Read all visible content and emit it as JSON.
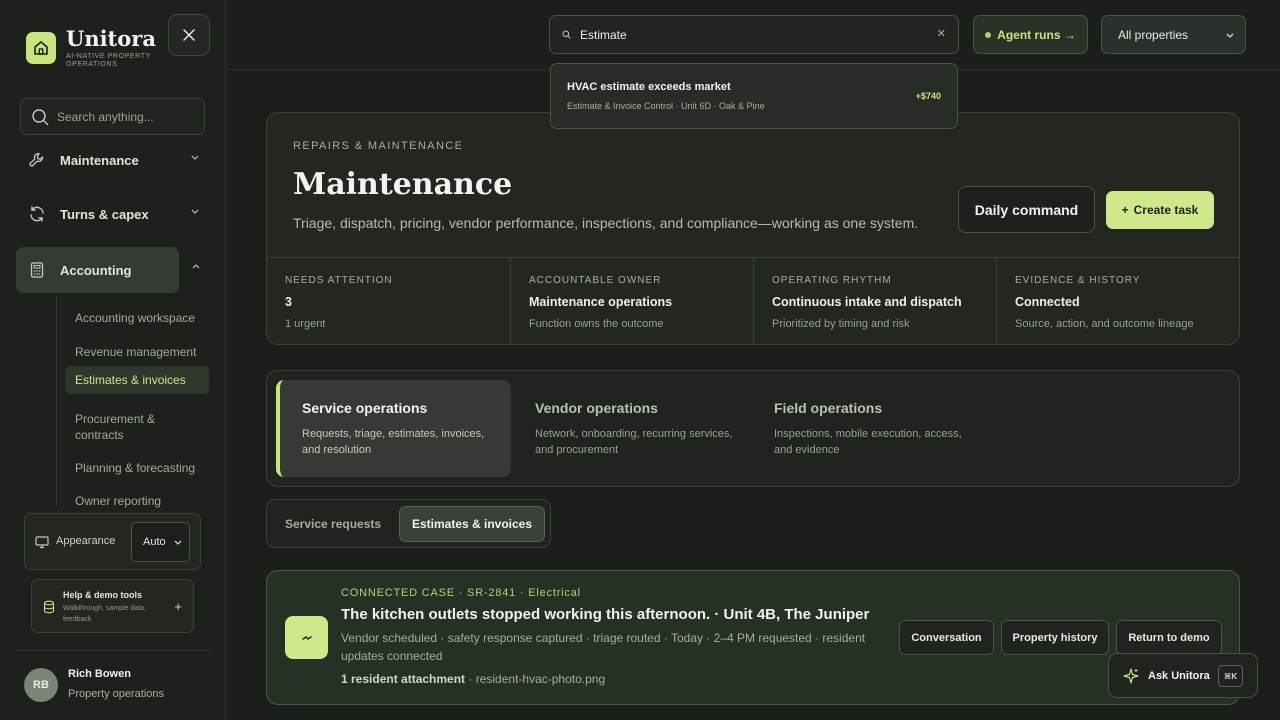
{
  "brand": {
    "name": "Unitora",
    "tagline": "AI-NATIVE PROPERTY OPERATIONS"
  },
  "sidebar": {
    "search_placeholder": "Search anything...",
    "nav": [
      {
        "label": "Maintenance",
        "icon": "wrench-icon"
      },
      {
        "label": "Turns & capex",
        "icon": "refresh-icon"
      },
      {
        "label": "Accounting",
        "icon": "calculator-icon",
        "expanded": true
      }
    ],
    "sub_items": [
      "Accounting workspace",
      "Revenue management",
      "Estimates & invoices",
      "Procurement & contracts",
      "Planning & forecasting",
      "Owner reporting"
    ],
    "active_sub": "Estimates & invoices",
    "appearance": {
      "label": "Appearance",
      "value": "Auto"
    },
    "help": {
      "title": "Help & demo tools",
      "subtitle": "Walkthrough, sample data, feedback"
    },
    "user": {
      "initials": "RB",
      "name": "Rich Bowen",
      "role": "Property operations"
    }
  },
  "topbar": {
    "search_value": "Estimate",
    "agent_runs": "Agent runs →",
    "property_select": "All properties"
  },
  "search_result": {
    "title": "HVAC estimate exceeds market",
    "subtitle": "Estimate & Invoice Control · Unit 6D · Oak & Pine",
    "amount": "+$740"
  },
  "header": {
    "eyebrow": "REPAIRS & MAINTENANCE",
    "title": "Maintenance",
    "subtitle": "Triage, dispatch, pricing, vendor performance, inspections, and compliance—working as one system.",
    "daily_btn": "Daily command",
    "create_btn": "Create task",
    "stats": [
      {
        "key": "NEEDS ATTENTION",
        "value": "3",
        "detail": "1 urgent"
      },
      {
        "key": "ACCOUNTABLE OWNER",
        "value": "Maintenance operations",
        "detail": "Function owns the outcome"
      },
      {
        "key": "OPERATING RHYTHM",
        "value": "Continuous intake and dispatch",
        "detail": "Prioritized by timing and risk"
      },
      {
        "key": "EVIDENCE & HISTORY",
        "value": "Connected",
        "detail": "Source, action, and outcome lineage"
      }
    ]
  },
  "categories": [
    {
      "title": "Service operations",
      "desc": "Requests, triage, estimates, invoices, and resolution"
    },
    {
      "title": "Vendor operations",
      "desc": "Network, onboarding, recurring services, and procurement"
    },
    {
      "title": "Field operations",
      "desc": "Inspections, mobile execution, access, and evidence"
    }
  ],
  "tabs": {
    "inactive": "Service requests",
    "active": "Estimates & invoices"
  },
  "case": {
    "eyebrow": "CONNECTED CASE · SR-2841 · Electrical",
    "title": "The kitchen outlets stopped working this afternoon. · Unit 4B, The Juniper",
    "meta": "Vendor scheduled · safety response captured · triage routed · Today · 2–4 PM requested · resident updates connected",
    "attach_label": "1 resident attachment",
    "attach_file": "· resident-hvac-photo.png",
    "buttons": [
      "Conversation",
      "Property history",
      "Return to demo"
    ]
  },
  "ask": {
    "label": "Ask Unitora",
    "shortcut": "⌘K"
  },
  "colors": {
    "accent": "#c9e37f",
    "background": "#1b1f1a"
  }
}
